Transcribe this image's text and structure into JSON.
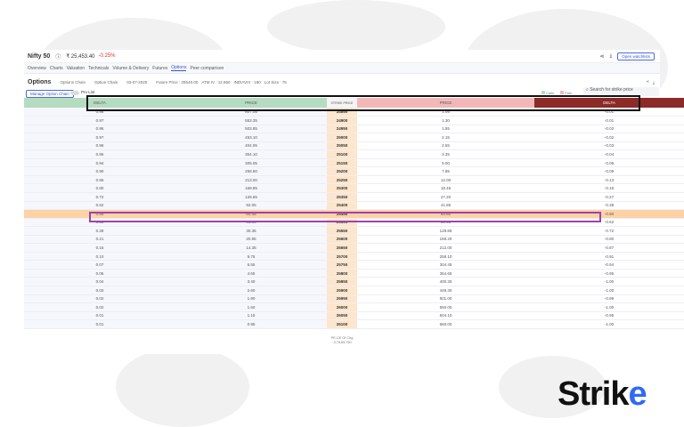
{
  "header": {
    "title": "Nifty 50",
    "price": "₹ 25,453.40",
    "change": "-0.25%",
    "watchlist_btn": "Open watchlists"
  },
  "tabs": [
    "Overview",
    "Charts",
    "Valuation",
    "Technicals",
    "Volume & Delivery",
    "Futures",
    "Options",
    "Peer comparison"
  ],
  "options_bar": {
    "title": "Options",
    "chain1": "Options Chain",
    "chain2": "Option Chain",
    "date": "03-07-2025",
    "future_price": "Future Price : 25540.00",
    "atm_iv": "ATM IV : 12.650",
    "indiavix": "INDIAVIX : 180",
    "lot_size": "Lot Size : 75"
  },
  "manage_btn": "Manage Option Chain",
  "toggle_label": "Pro List",
  "legend": {
    "calls": "Calls",
    "puts": "Puts"
  },
  "search_placeholder": "Search for strike price",
  "columns": {
    "call_delta": "DELTA",
    "call_price": "PRICE",
    "strike": "STRIKE PRICE",
    "put_price": "PRICE",
    "put_delta": "DELTA"
  },
  "rows": [
    [
      "0.98",
      "607.05",
      "24850",
      "1.05",
      "-0.01"
    ],
    [
      "0.97",
      "553.35",
      "24900",
      "1.30",
      "-0.01"
    ],
    [
      "0.96",
      "503.85",
      "24950",
      "1.55",
      "-0.02"
    ],
    [
      "0.97",
      "453.10",
      "25000",
      "2.15",
      "-0.02"
    ],
    [
      "0.96",
      "404.05",
      "25050",
      "2.55",
      "-0.03"
    ],
    [
      "0.95",
      "354.10",
      "25100",
      "3.35",
      "-0.04"
    ],
    [
      "0.94",
      "305.05",
      "25150",
      "5.00",
      "-0.06"
    ],
    [
      "0.90",
      "258.60",
      "25200",
      "7.85",
      "-0.09"
    ],
    [
      "0.86",
      "213.00",
      "25250",
      "12.00",
      "-0.13"
    ],
    [
      "0.80",
      "169.85",
      "25300",
      "18.45",
      "-0.19"
    ],
    [
      "0.72",
      "128.65",
      "25350",
      "27.20",
      "-0.27"
    ],
    [
      "0.62",
      "92.05",
      "25400",
      "41.85",
      "-0.38"
    ],
    [
      "0.50",
      "64.45",
      "25450",
      "63.60",
      "-0.50"
    ],
    [
      "0.38",
      "44.00",
      "25500",
      "92.95",
      "-0.62"
    ],
    [
      "0.28",
      "30.35",
      "25550",
      "128.85",
      "-0.72"
    ],
    [
      "0.21",
      "20.95",
      "25600",
      "169.20",
      "-0.80"
    ],
    [
      "0.15",
      "14.35",
      "25650",
      "212.00",
      "-0.87"
    ],
    [
      "0.10",
      "9.75",
      "25700",
      "258.10",
      "-0.91"
    ],
    [
      "0.07",
      "6.55",
      "25750",
      "304.45",
      "-0.94"
    ],
    [
      "0.05",
      "4.65",
      "25800",
      "354.65",
      "-0.95"
    ],
    [
      "0.04",
      "3.40",
      "25850",
      "400.30",
      "-1.00"
    ],
    [
      "0.03",
      "2.60",
      "25900",
      "449.30",
      "-1.00"
    ],
    [
      "0.02",
      "1.90",
      "25950",
      "501.00",
      "-0.99"
    ],
    [
      "0.02",
      "1.60",
      "26000",
      "550.00",
      "-1.00"
    ],
    [
      "0.01",
      "1.15",
      "26050",
      "604.10",
      "-0.95"
    ],
    [
      "0.01",
      "0.95",
      "26100",
      "650.00",
      "-1.00"
    ]
  ],
  "atm_index": 12,
  "footer": {
    "label": "PE-CE OI Chg",
    "value": "-3,78,65,750"
  },
  "logo": "Strike",
  "colors": {
    "call_header": "#b5dcc0",
    "put_price_header": "#f2b8b8",
    "put_delta_header": "#8b2a26",
    "highlight_box": "#a040b0",
    "atm_row": "#fdd3a6"
  }
}
